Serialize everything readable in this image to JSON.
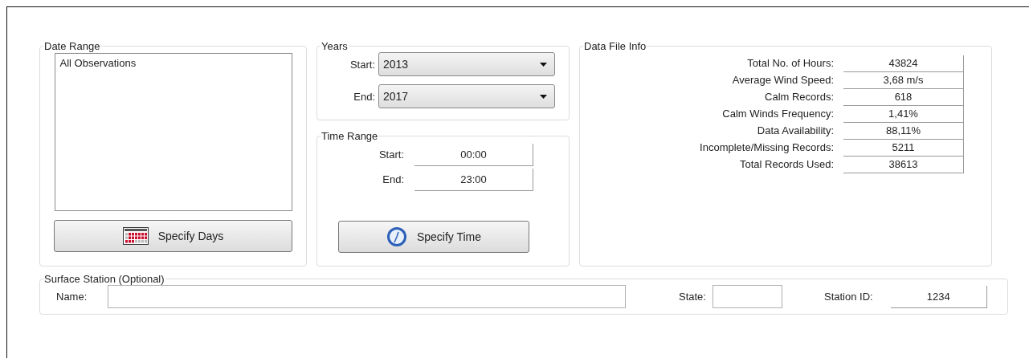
{
  "date_range": {
    "legend": "Date Range",
    "list_items": [
      "All Observations"
    ],
    "button": "Specify Days"
  },
  "years": {
    "legend": "Years",
    "fields": [
      {
        "label": "Start:",
        "value": "2013"
      },
      {
        "label": "End:",
        "value": "2017"
      }
    ]
  },
  "time_range": {
    "legend": "Time Range",
    "fields": [
      {
        "label": "Start:",
        "value": "00:00"
      },
      {
        "label": "End:",
        "value": "23:00"
      }
    ],
    "button": "Specify Time"
  },
  "data_file_info": {
    "legend": "Data File Info",
    "rows": [
      {
        "label": "Total No. of Hours:",
        "value": "43824"
      },
      {
        "label": "Average Wind Speed:",
        "value": "3,68 m/s"
      },
      {
        "label": "Calm Records:",
        "value": "618"
      },
      {
        "label": "Calm Winds Frequency:",
        "value": "1,41%"
      },
      {
        "label": "Data Availability:",
        "value": "88,11%"
      },
      {
        "label": "Incomplete/Missing Records:",
        "value": "5211"
      },
      {
        "label": "Total Records Used:",
        "value": "38613"
      }
    ]
  },
  "surface_station": {
    "legend": "Surface Station (Optional)",
    "name_label": "Name:",
    "state_label": "State:",
    "station_id_label": "Station ID:",
    "station_id": "1234"
  }
}
